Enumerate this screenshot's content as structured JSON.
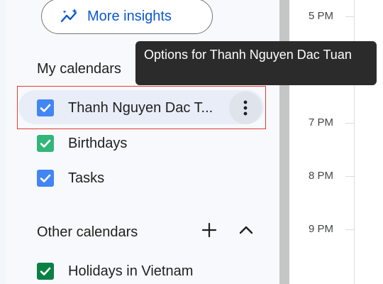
{
  "insights_button": {
    "label": "More insights",
    "icon": "insights-icon",
    "color": "#0b57d0"
  },
  "tooltip": {
    "text": "Options for Thanh Nguyen Dac Tuan"
  },
  "my_calendars": {
    "title": "My calendars",
    "items": [
      {
        "label": "Thanh Nguyen Dac T...",
        "checked": true,
        "color": "#4285f4"
      },
      {
        "label": "Birthdays",
        "checked": true,
        "color": "#33b679"
      },
      {
        "label": "Tasks",
        "checked": true,
        "color": "#4285f4"
      }
    ]
  },
  "other_calendars": {
    "title": "Other calendars",
    "add_icon": "plus-icon",
    "collapse_icon": "chevron-up-icon",
    "items": [
      {
        "label": "Holidays in Vietnam",
        "checked": true,
        "color": "#0b8043"
      }
    ]
  },
  "time_column": {
    "labels": [
      "5 PM",
      "7 PM",
      "8 PM",
      "9 PM"
    ]
  }
}
